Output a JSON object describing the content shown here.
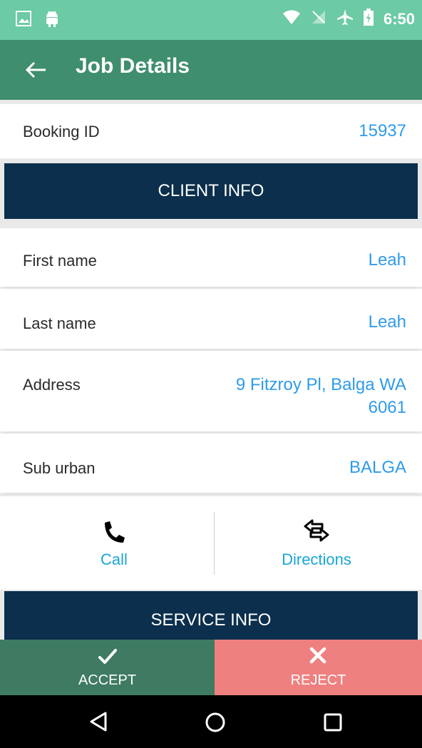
{
  "status_bar": {
    "time": "6:50"
  },
  "app_bar": {
    "title": "Job Details"
  },
  "booking": {
    "label": "Booking ID",
    "value": "15937"
  },
  "client_section": {
    "header": "CLIENT INFO"
  },
  "client": {
    "first_name": {
      "label": "First name",
      "value": "Leah"
    },
    "last_name": {
      "label": "Last name",
      "value": "Leah"
    },
    "address": {
      "label": "Address",
      "value_line1": "9 Fitzroy Pl, Balga WA",
      "value_line2": "6061"
    },
    "suburb": {
      "label": "Sub urban",
      "value": "BALGA"
    }
  },
  "actions": {
    "call_label": "Call",
    "directions_label": "Directions"
  },
  "service_section": {
    "header": "SERVICE INFO"
  },
  "bottom_buttons": {
    "accept_label": "ACCEPT",
    "reject_label": "REJECT"
  },
  "colors": {
    "status_bar": "#6ccaa4",
    "app_bar": "#3f8e6d",
    "section_header": "#0b2f4c",
    "value_text": "#2f9be8",
    "action_text": "#1ba6d6",
    "accept": "#3e7b62",
    "reject": "#ef8080"
  },
  "icons": [
    "image-icon",
    "android-icon",
    "wifi-icon",
    "no-sim-icon",
    "airplane-icon",
    "battery-icon",
    "back-arrow-icon",
    "phone-icon",
    "directions-icon",
    "check-icon",
    "close-icon",
    "nav-back-icon",
    "nav-home-icon",
    "nav-recents-icon"
  ]
}
